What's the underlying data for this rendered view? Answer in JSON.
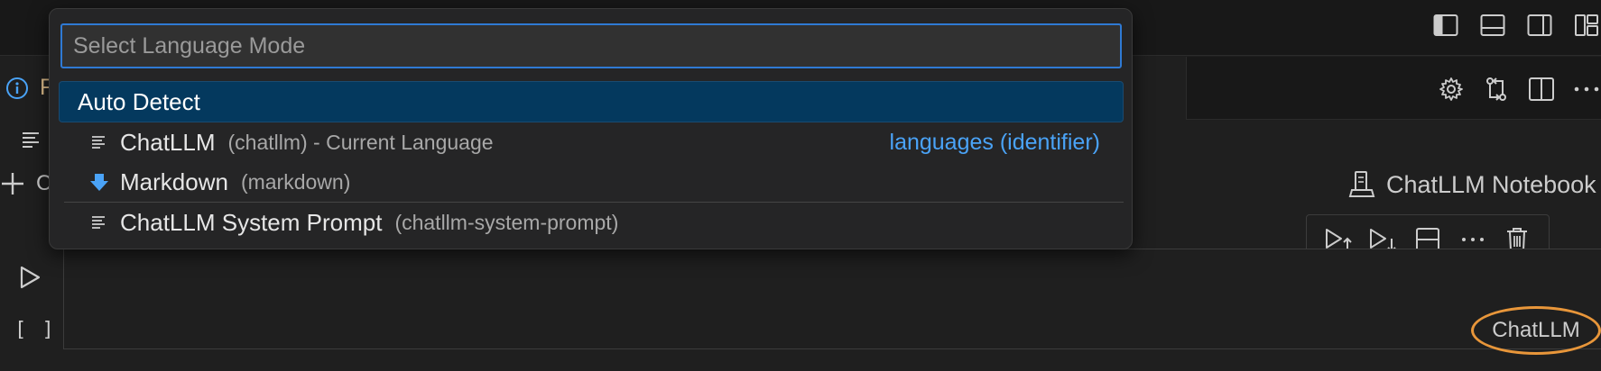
{
  "colors": {
    "accent": "#2f7ad4",
    "selection": "#04395e",
    "link": "#4aa3f7",
    "highlight_ring": "#e8963a",
    "warning_text": "#e2c08d"
  },
  "titlebar": {
    "layout_icons": [
      "toggle-primary-sidebar-icon",
      "toggle-panel-icon",
      "toggle-secondary-sidebar-icon",
      "customize-layout-icon"
    ]
  },
  "tabbar": {
    "tab_label_partial": "F",
    "actions": [
      "gear-icon",
      "compare-changes-icon",
      "split-editor-icon",
      "more-actions-icon"
    ]
  },
  "notebook": {
    "add_cell_label_partial": "C",
    "kernel_label": "ChatLLM Notebook",
    "exec_count": "[ ]",
    "cell_language": "ChatLLM",
    "cell_toolbar": [
      "run-above-icon",
      "run-below-icon",
      "split-cell-icon",
      "more-icon",
      "delete-cell-icon"
    ]
  },
  "quickpick": {
    "placeholder": "Select Language Mode",
    "items": [
      {
        "name": "Auto Detect",
        "desc": "",
        "group": "",
        "icon": "",
        "selected": true
      },
      {
        "name": "ChatLLM",
        "desc": "(chatllm) - Current Language",
        "group": "languages (identifier)",
        "icon": "lines-icon",
        "selected": false
      },
      {
        "name": "Markdown",
        "desc": "(markdown)",
        "group": "",
        "icon": "markdown-arrow-icon",
        "selected": false
      },
      {
        "name": "ChatLLM System Prompt",
        "desc": "(chatllm-system-prompt)",
        "group": "",
        "icon": "lines-icon",
        "selected": false
      }
    ]
  }
}
